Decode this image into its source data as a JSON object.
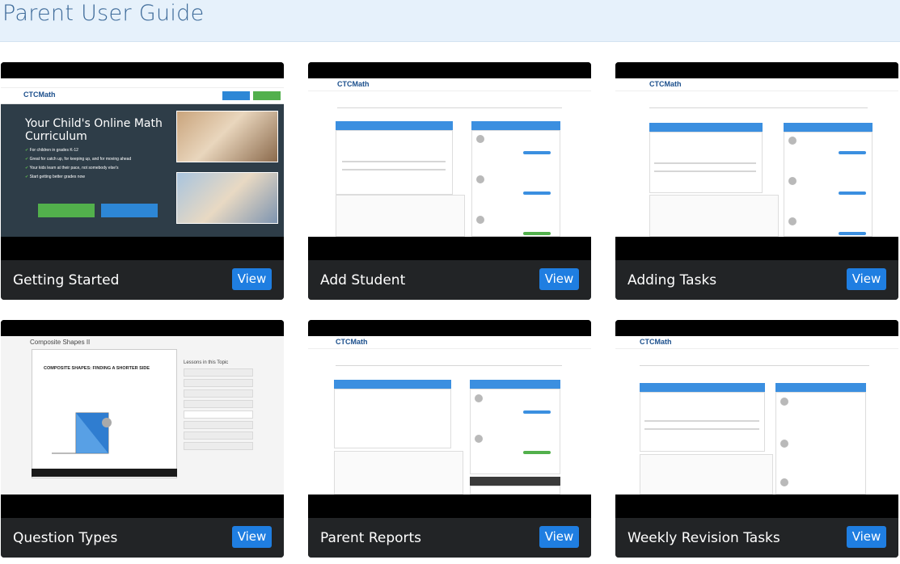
{
  "page": {
    "title": "Parent User Guide"
  },
  "cards": [
    {
      "title": "Getting Started",
      "view_label": "View"
    },
    {
      "title": "Add Student",
      "view_label": "View"
    },
    {
      "title": "Adding Tasks",
      "view_label": "View"
    },
    {
      "title": "Question Types",
      "view_label": "View"
    },
    {
      "title": "Parent Reports",
      "view_label": "View"
    },
    {
      "title": "Weekly Revision Tasks",
      "view_label": "View"
    }
  ],
  "thumbs": {
    "logo": "CTCMath",
    "hero_title": "Your Child's Online Math Curriculum",
    "hero_bullets": [
      "For children in grades K-12",
      "Great for catch up, for keeping up, and for moving ahead",
      "Your kids learn at their pace, not somebody else's",
      "Start getting better grades now"
    ],
    "video_title": "Composite Shapes II",
    "video_heading": "COMPOSITE SHAPES: FINDING A SHORTER SIDE",
    "lessons_heading": "Lessons in this Topic"
  }
}
